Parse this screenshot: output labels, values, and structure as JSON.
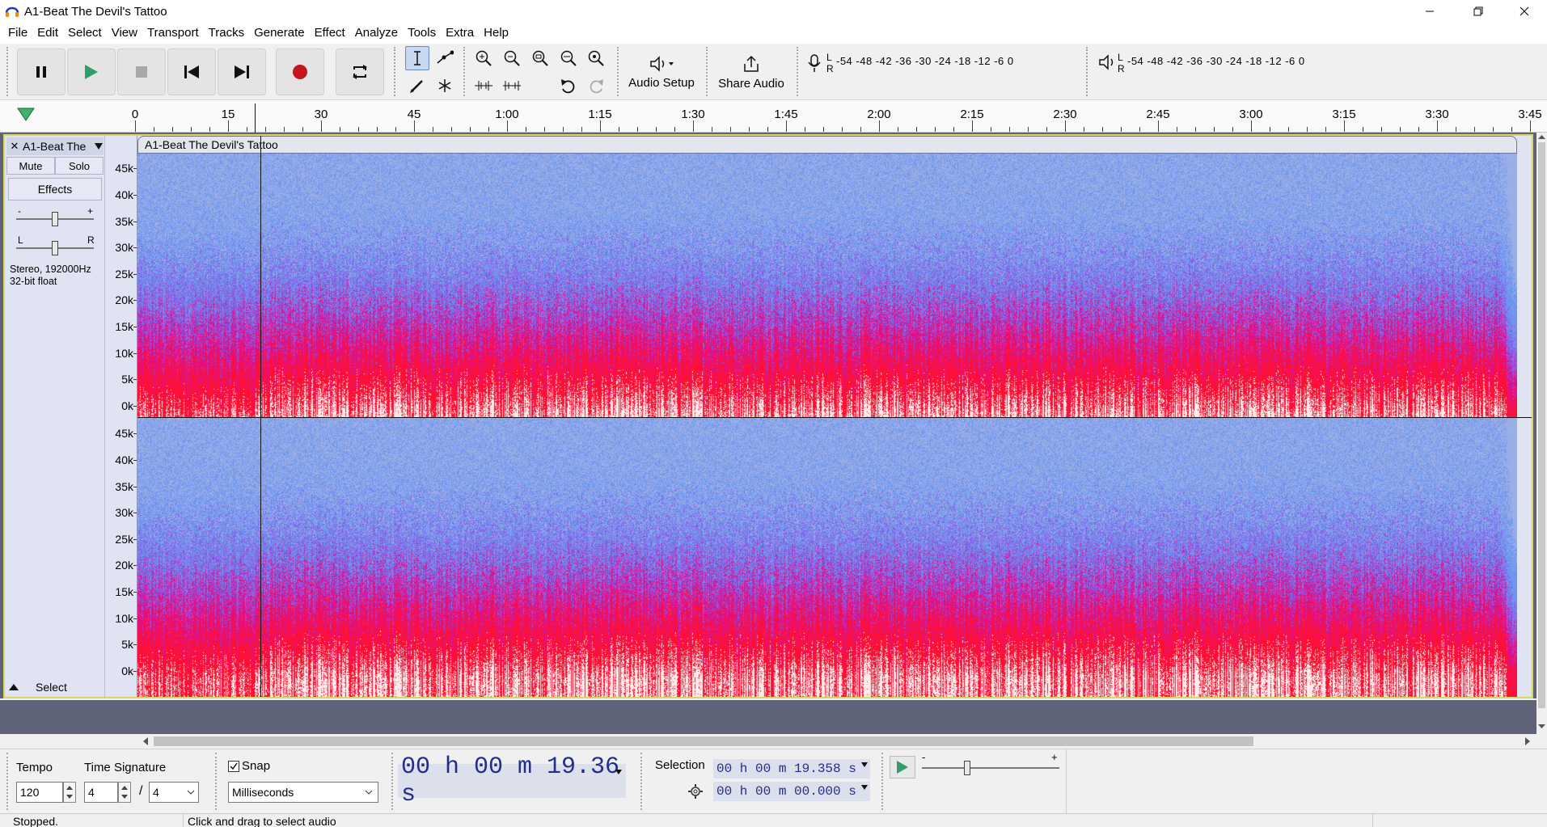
{
  "window": {
    "title": "A1-Beat The Devil's Tattoo"
  },
  "menu": [
    "File",
    "Edit",
    "Select",
    "View",
    "Transport",
    "Tracks",
    "Generate",
    "Effect",
    "Analyze",
    "Tools",
    "Extra",
    "Help"
  ],
  "toolbar": {
    "audio_setup_label": "Audio Setup",
    "share_audio_label": "Share Audio",
    "rec_meter_ticks": "-54 -48 -42 -36 -30 -24 -18 -12 -6 0",
    "play_meter_ticks": "-54 -48 -42 -36 -30 -24 -18 -12 -6 0",
    "meter_lr": "L\nR"
  },
  "ruler": {
    "labels": [
      "0",
      "15",
      "30",
      "45",
      "1:00",
      "1:15",
      "1:30",
      "1:45",
      "2:00",
      "2:15",
      "2:30",
      "2:45",
      "3:00",
      "3:15",
      "3:30",
      "3:45"
    ]
  },
  "track": {
    "name": "A1-Beat The",
    "clip_name": "A1-Beat The Devil's Tattoo",
    "mute_label": "Mute",
    "solo_label": "Solo",
    "effects_label": "Effects",
    "format_line1": "Stereo, 192000Hz",
    "format_line2": "32-bit float",
    "select_label": "Select",
    "close_glyph": "✕",
    "gain_minus": "-",
    "gain_plus": "+",
    "pan_left": "L",
    "pan_right": "R",
    "freq_labels": [
      "45k",
      "40k",
      "35k",
      "30k",
      "25k",
      "20k",
      "15k",
      "10k",
      "5k",
      "0k"
    ]
  },
  "bottom": {
    "tempo_label": "Tempo",
    "tempo_value": "120",
    "time_sig_label": "Time Signature",
    "time_sig_num": "4",
    "time_sig_den": "4",
    "slash": "/",
    "snap_label": "Snap",
    "snap_checked": true,
    "snap_unit": "Milliseconds",
    "big_time": "00 h 00 m 19.36 s",
    "selection_label": "Selection",
    "sel_start": "00 h 00 m 19.358 s",
    "sel_length": "00 h 00 m 00.000 s",
    "speed_minus": "-",
    "speed_plus": "+"
  },
  "status": {
    "left": "Stopped.",
    "right": "Click and drag to select audio"
  },
  "colors": {
    "spectrogram_low": "#ff1030",
    "spectrogram_mid": "#e0108a",
    "spectrogram_high": "#6f96ee",
    "spectrogram_top": "#9aaee8",
    "track_border": "#dcd65a",
    "accent": "#2f9e6b"
  }
}
